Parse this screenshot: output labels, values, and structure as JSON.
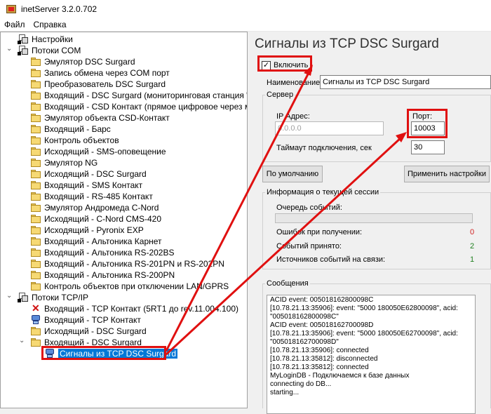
{
  "window": {
    "title": "inetServer 3.2.0.702"
  },
  "menu": {
    "file": "Файл",
    "help": "Справка"
  },
  "tree": {
    "items": [
      {
        "label": "Настройки",
        "icon": "group-icon",
        "level": 0
      },
      {
        "label": "Потоки COM",
        "icon": "group-icon",
        "level": 0,
        "expanded": true
      },
      {
        "label": "Эмулятор DSC Surgard",
        "icon": "folder-icon",
        "level": 1
      },
      {
        "label": "Запись обмена через COM порт",
        "icon": "folder-icon",
        "level": 1
      },
      {
        "label": "Преобразователь DSC Surgard",
        "icon": "folder-icon",
        "level": 1
      },
      {
        "label": "Входящий - DSC Surgard (мониторинговая станция \"Конт",
        "icon": "folder-icon",
        "level": 1
      },
      {
        "label": "Входящий - CSD Контакт (прямое цифровое через модем",
        "icon": "folder-icon",
        "level": 1
      },
      {
        "label": "Эмулятор объекта CSD-Контакт",
        "icon": "folder-icon",
        "level": 1
      },
      {
        "label": "Входящий - Барс",
        "icon": "folder-icon",
        "level": 1
      },
      {
        "label": "Контроль объектов",
        "icon": "folder-icon",
        "level": 1
      },
      {
        "label": "Исходящий - SMS-оповещение",
        "icon": "folder-icon",
        "level": 1
      },
      {
        "label": "Эмулятор NG",
        "icon": "folder-icon",
        "level": 1
      },
      {
        "label": "Исходящий - DSC Surgard",
        "icon": "folder-icon",
        "level": 1
      },
      {
        "label": "Входящий - SMS Контакт",
        "icon": "folder-icon",
        "level": 1
      },
      {
        "label": "Входящий - RS-485 Контакт",
        "icon": "folder-icon",
        "level": 1
      },
      {
        "label": "Эмулятор Андромеда C-Nord",
        "icon": "folder-icon",
        "level": 1
      },
      {
        "label": "Исходящий - C-Nord CMS-420",
        "icon": "folder-icon",
        "level": 1
      },
      {
        "label": "Исходящий - Pyronix EXP",
        "icon": "folder-icon",
        "level": 1
      },
      {
        "label": "Входящий - Альтоника Карнет",
        "icon": "folder-icon",
        "level": 1
      },
      {
        "label": "Входящий - Альтоника RS-202BS",
        "icon": "folder-icon",
        "level": 1
      },
      {
        "label": "Входящий - Альтоника RS-201PN и RS-202PN",
        "icon": "folder-icon",
        "level": 1
      },
      {
        "label": "Входящий - Альтоника RS-200PN",
        "icon": "folder-icon",
        "level": 1
      },
      {
        "label": "Контроль объектов при отключении LAN/GPRS",
        "icon": "folder-icon",
        "level": 1
      },
      {
        "label": "Потоки TCP/IP",
        "icon": "group-icon",
        "level": 0,
        "expanded": true
      },
      {
        "label": "Входящий - TCP Контакт (5RT1 до rev.11.004.100)",
        "icon": "error-icon",
        "level": 1
      },
      {
        "label": "Входящий - TCP Контакт",
        "icon": "network-icon",
        "level": 1
      },
      {
        "label": "Исходящий - DSC Surgard",
        "icon": "folder-icon",
        "level": 1
      },
      {
        "label": "Входящий - DSC Surgard",
        "icon": "folder-icon",
        "level": 1,
        "expanded": true
      },
      {
        "label": "Сигналы из TCP DSC Surgard",
        "icon": "network-icon",
        "level": 2,
        "selected": true
      }
    ]
  },
  "panel": {
    "title": "Сигналы из TCP DSC Surgard",
    "enable_label": "Включить",
    "enable_checked": true,
    "name_label": "Наименование:",
    "name_value": "Сигналы из TCP DSC Surgard",
    "server_group": "Сервер",
    "ip_label": "IP Адрес:",
    "ip_value": "0.0.0.0",
    "port_label": "Порт:",
    "port_value": "10003",
    "timeout_label": "Таймаут подключения, сек",
    "timeout_value": "30",
    "default_button": "По умолчанию",
    "apply_button": "Применить настройки",
    "session_group": "Информация о текущей сессии",
    "queue_label": "Очередь событий:",
    "queue_progress": 0,
    "errors_label": "Ошибок при получении:",
    "errors_value": "0",
    "received_label": "Событий принято:",
    "received_value": "2",
    "sources_label": "Источников событий на связи:",
    "sources_value": "1",
    "messages_group": "Сообщения",
    "log": [
      "ACID event: 005018162800098C",
      "[10.78.21.13:35906]: event: \"5000 180050E62800098\", acid:",
      "\"005018162800098C\"",
      "ACID event: 005018162700098D",
      "[10.78.21.13:35906]: event: \"5000 180050E62700098\", acid:",
      "\"005018162700098D\"",
      "[10.78.21.13:35906]: connected",
      "[10.78.21.13:35812]: disconnected",
      "[10.78.21.13:35812]: connected",
      "MyLoginDB - Подключаемся к базе данных",
      "connecting do DB...",
      "starting..."
    ],
    "colors": {
      "error": "#d02020",
      "ok": "#208020",
      "highlight": "#e01010",
      "selection": "#0078d7"
    }
  }
}
